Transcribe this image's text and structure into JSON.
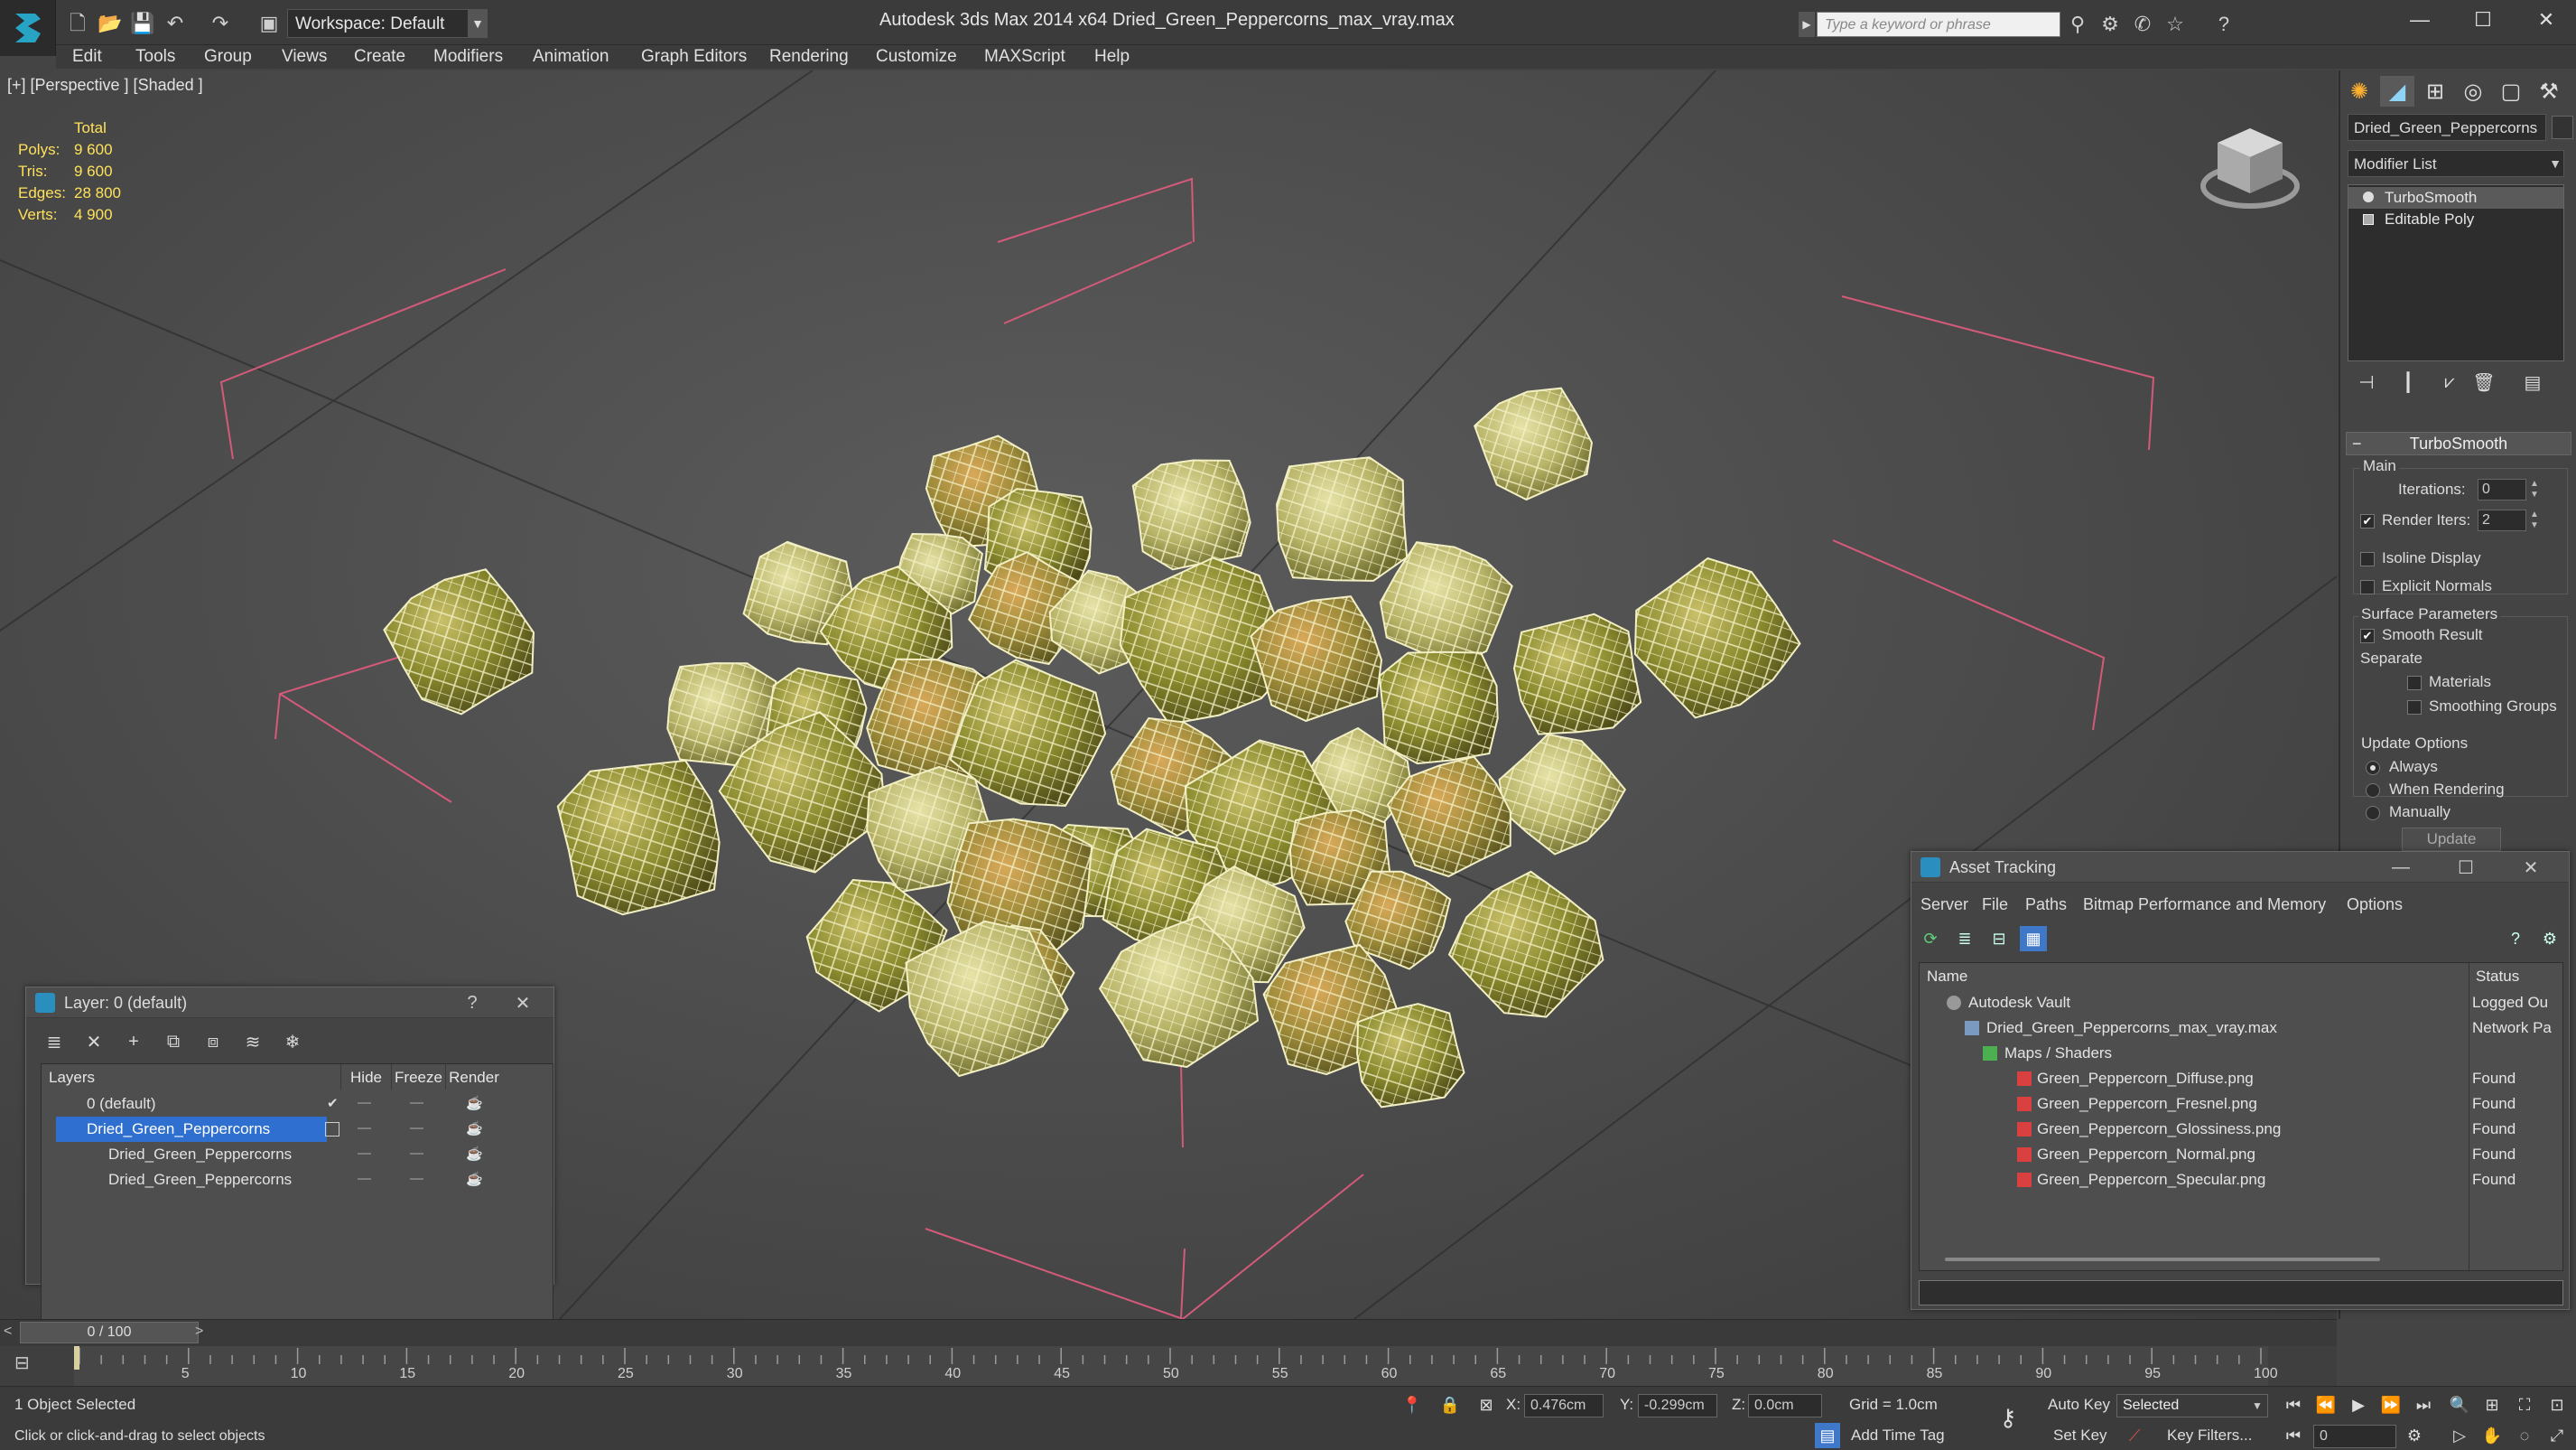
{
  "titlebar": {
    "workspace": "Workspace: Default",
    "app_title": "Autodesk 3ds Max  2014 x64",
    "file_title": "Dried_Green_Peppercorns_max_vray.max",
    "search_placeholder": "Type a keyword or phrase"
  },
  "menu": [
    "Edit",
    "Tools",
    "Group",
    "Views",
    "Create",
    "Modifiers",
    "Animation",
    "Graph Editors",
    "Rendering",
    "Customize",
    "MAXScript",
    "Help"
  ],
  "viewport": {
    "label": "[+] [Perspective ] [Shaded ]",
    "stats": {
      "header": "Total",
      "rows": [
        {
          "k": "Polys:",
          "v": "9 600"
        },
        {
          "k": "Tris:",
          "v": "9 600"
        },
        {
          "k": "Edges:",
          "v": "28 800"
        },
        {
          "k": "Verts:",
          "v": "4 900"
        }
      ]
    }
  },
  "command_panel": {
    "object_name": "Dried_Green_Peppercorns",
    "modifier_list": "Modifier List",
    "stack": [
      "TurboSmooth",
      "Editable Poly"
    ],
    "rollout_title": "TurboSmooth",
    "main_group": "Main",
    "iterations_label": "Iterations:",
    "iterations_value": "0",
    "render_iters_label": "Render Iters:",
    "render_iters_value": "2",
    "isoline": "Isoline Display",
    "explicit_normals": "Explicit Normals",
    "surface_group": "Surface Parameters",
    "smooth_result": "Smooth Result",
    "separate": "Separate",
    "materials": "Materials",
    "smoothing_groups": "Smoothing Groups",
    "update_group": "Update Options",
    "always": "Always",
    "when_rendering": "When Rendering",
    "manually": "Manually",
    "update_button": "Update"
  },
  "layer_dialog": {
    "title": "Layer: 0 (default)",
    "help": "?",
    "columns": [
      "Layers",
      "Hide",
      "Freeze",
      "Render"
    ],
    "rows": [
      {
        "name": "0 (default)",
        "mark": "✔"
      },
      {
        "name": "Dried_Green_Peppercorns",
        "mark": ""
      },
      {
        "name": "Dried_Green_Peppercorns",
        "mark": ""
      },
      {
        "name": "Dried_Green_Peppercorns",
        "mark": ""
      }
    ]
  },
  "asset_dialog": {
    "title": "Asset Tracking",
    "menus": [
      "Server",
      "File",
      "Paths",
      "Bitmap Performance and Memory",
      "Options"
    ],
    "columns": [
      "Name",
      "Status"
    ],
    "rows": [
      {
        "name": "Autodesk Vault",
        "status": "Logged Ou"
      },
      {
        "name": "Dried_Green_Peppercorns_max_vray.max",
        "status": "Network Pa"
      },
      {
        "name": "Maps / Shaders",
        "status": ""
      },
      {
        "name": "Green_Peppercorn_Diffuse.png",
        "status": "Found"
      },
      {
        "name": "Green_Peppercorn_Fresnel.png",
        "status": "Found"
      },
      {
        "name": "Green_Peppercorn_Glossiness.png",
        "status": "Found"
      },
      {
        "name": "Green_Peppercorn_Normal.png",
        "status": "Found"
      },
      {
        "name": "Green_Peppercorn_Specular.png",
        "status": "Found"
      }
    ]
  },
  "timeline": {
    "frame": "0 / 100",
    "ticks": [
      "5",
      "10",
      "15",
      "20",
      "25",
      "30",
      "35",
      "40",
      "45",
      "50",
      "55",
      "60",
      "65",
      "70",
      "75",
      "80",
      "85",
      "90",
      "95",
      "100"
    ]
  },
  "status": {
    "selection": "1 Object Selected",
    "prompt": "Click or click-and-drag to select objects",
    "x_label": "X:",
    "x_value": "0.476cm",
    "y_label": "Y:",
    "y_value": "-0.299cm",
    "z_label": "Z:",
    "z_value": "0.0cm",
    "grid": "Grid = 1.0cm",
    "auto_key": "Auto Key",
    "selected": "Selected",
    "set_key": "Set Key",
    "key_filters": "Key Filters...",
    "add_time_tag": "Add Time Tag",
    "frame_value": "0"
  },
  "colors": {
    "stats": "#ffe15a",
    "selection_blue": "#2f6fd0",
    "bbox_pink": "#d45a7a"
  }
}
